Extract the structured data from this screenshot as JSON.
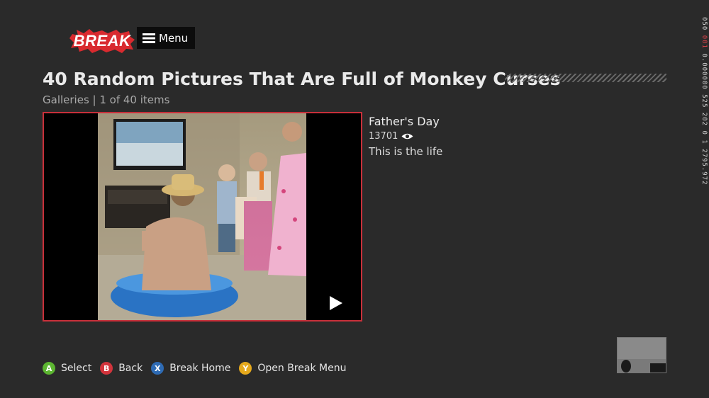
{
  "header": {
    "logo_text": "BREAK",
    "menu_label": "Menu"
  },
  "page": {
    "title": "40 Random Pictures That Are Full of Monkey Curses",
    "subtitle": "Galleries | 1 of 40 items"
  },
  "item": {
    "title": "Father's Day",
    "views": "13701",
    "description": "This is the life"
  },
  "controls": [
    {
      "button": "A",
      "label": "Select",
      "color": "#5cb531"
    },
    {
      "button": "B",
      "label": "Back",
      "color": "#d2343c"
    },
    {
      "button": "X",
      "label": "Break Home",
      "color": "#2e6bb4"
    },
    {
      "button": "Y",
      "label": "Open Break Menu",
      "color": "#e6a91c"
    }
  ],
  "debug_strip": {
    "part1": "050 ",
    "part2_highlight": "001",
    "part3": " 0.000000 525 202 0 1 2795.972"
  },
  "colors": {
    "accent": "#c8303a",
    "background": "#2a2a2a"
  }
}
